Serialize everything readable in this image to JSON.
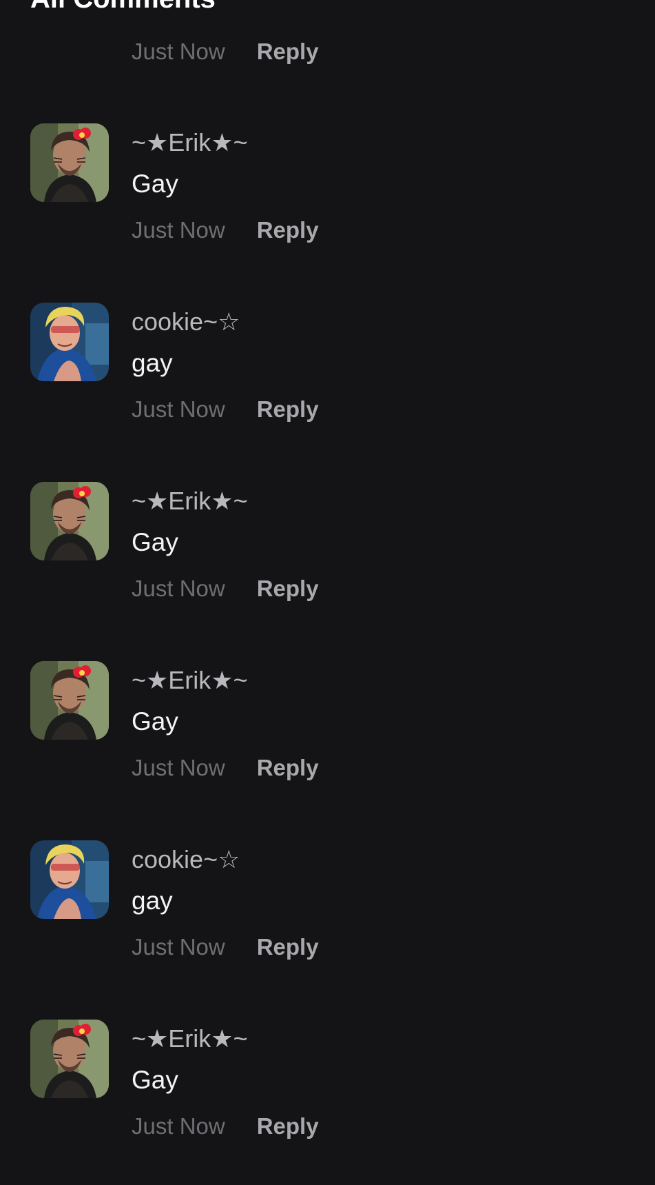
{
  "section": {
    "title": "All Comments"
  },
  "top_meta": {
    "time": "Just Now",
    "reply": "Reply"
  },
  "comments": [
    {
      "author": "~★Erik★~",
      "text": "Gay",
      "time": "Just Now",
      "reply": "Reply",
      "avatar": "erik-avatar"
    },
    {
      "author": "cookie~☆",
      "text": "gay",
      "time": "Just Now",
      "reply": "Reply",
      "avatar": "cookie-avatar"
    },
    {
      "author": "~★Erik★~",
      "text": "Gay",
      "time": "Just Now",
      "reply": "Reply",
      "avatar": "erik-avatar"
    },
    {
      "author": "~★Erik★~",
      "text": "Gay",
      "time": "Just Now",
      "reply": "Reply",
      "avatar": "erik-avatar"
    },
    {
      "author": "cookie~☆",
      "text": "gay",
      "time": "Just Now",
      "reply": "Reply",
      "avatar": "cookie-avatar"
    },
    {
      "author": "~★Erik★~",
      "text": "Gay",
      "time": "Just Now",
      "reply": "Reply",
      "avatar": "erik-avatar"
    }
  ],
  "colors": {
    "background": "#141416",
    "author": "#b9b9bd",
    "text": "#f4f4f4",
    "time": "#6f6f73",
    "reply": "#a9a9ad"
  }
}
